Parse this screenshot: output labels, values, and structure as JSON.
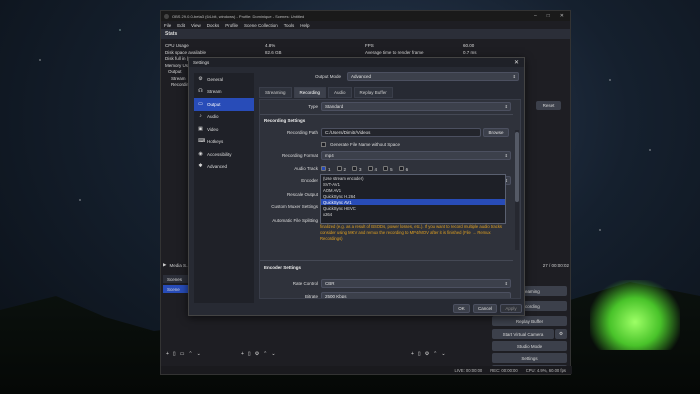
{
  "obs": {
    "title": "OBS 29.0.0-beta3 (64-bit, windows) - Profile: Dominique - Scenes: Untitled",
    "menu": [
      "File",
      "Edit",
      "View",
      "Docks",
      "Profile",
      "Scene Collection",
      "Tools",
      "Help"
    ],
    "stats_label": "Stats",
    "stats": [
      [
        "CPU Usage",
        "4.8%",
        "FPS",
        "60.00"
      ],
      [
        "Disk space available",
        "82.6 GB",
        "Average time to render frame",
        "0.7 ms"
      ],
      [
        "Disk full in (a...",
        "",
        "",
        ""
      ],
      [
        "Memory Usa...",
        "",
        "",
        ""
      ]
    ],
    "stats_left_sub": [
      "Output",
      "Stream",
      "Recording"
    ],
    "reset": "Reset",
    "media_bar_label": "Media S...",
    "media_time": "27 / 00:00:02",
    "scenes_label": "Scenes",
    "scene_item": "Scene",
    "controls": [
      "Streaming",
      "Recording",
      "Replay Buffer",
      "Start Virtual Camera",
      "Studio Mode",
      "Settings",
      "Exit"
    ],
    "status": {
      "live": "LIVE: 00:00:00",
      "rec": "REC: 00:00:00",
      "cpu": "CPU: 4.9%, 60.00 fps"
    }
  },
  "settings": {
    "title": "Settings",
    "sidebar": [
      {
        "label": "General",
        "icon": "gear-icon",
        "glyph": "⚙"
      },
      {
        "label": "Stream",
        "icon": "broadcast-icon",
        "glyph": "☊"
      },
      {
        "label": "Output",
        "icon": "output-icon",
        "glyph": "▭",
        "active": true
      },
      {
        "label": "Audio",
        "icon": "speaker-icon",
        "glyph": "♪"
      },
      {
        "label": "Video",
        "icon": "monitor-icon",
        "glyph": "▣"
      },
      {
        "label": "Hotkeys",
        "icon": "keyboard-icon",
        "glyph": "⌨"
      },
      {
        "label": "Accessibility",
        "icon": "accessibility-icon",
        "glyph": "◉"
      },
      {
        "label": "Advanced",
        "icon": "wrench-icon",
        "glyph": "✱"
      }
    ],
    "output_mode_label": "Output Mode",
    "output_mode_value": "Advanced",
    "tabs": [
      "Streaming",
      "Recording",
      "Audio",
      "Replay Buffer"
    ],
    "active_tab": "Recording",
    "type_label": "Type",
    "type_value": "Standard",
    "recording_settings_title": "Recording Settings",
    "recording_path_label": "Recording Path",
    "recording_path_value": "C:/Users/Dimitr/Videos",
    "browse": "Browse",
    "gen_filename_label": "Generate File Name without Space",
    "recording_format_label": "Recording Format",
    "recording_format_value": "mp4",
    "audio_track_label": "Audio Track",
    "audio_tracks": [
      "1",
      "2",
      "3",
      "4",
      "5",
      "6"
    ],
    "encoder_label": "Encoder",
    "encoder_value": "QuickSync AV1",
    "encoder_options": [
      "(Use stream encoder)",
      "SVT-AV1",
      "AOM AV1",
      "QuickSync H.264",
      "QuickSync AV1",
      "QuickSync HEVC",
      "x264"
    ],
    "encoder_highlighted": "QuickSync AV1",
    "rescale_label": "Rescale Output",
    "custom_muxer_label": "Custom Muxer Settings",
    "auto_split_label": "Automatic File Splitting",
    "warning": "finalized (e.g. as a result of BSODs, power losses, etc.). If you want to record multiple audio tracks consider using MKV and remux the recording to MP4/MOV after it is finished (File → Remux Recordings)",
    "encoder_settings_title": "Encoder Settings",
    "rate_control_label": "Rate Control",
    "rate_control_value": "CBR",
    "bitrate_label": "Bitrate",
    "bitrate_value": "2500 Kbps",
    "ok": "OK",
    "cancel": "Cancel",
    "apply": "Apply"
  }
}
